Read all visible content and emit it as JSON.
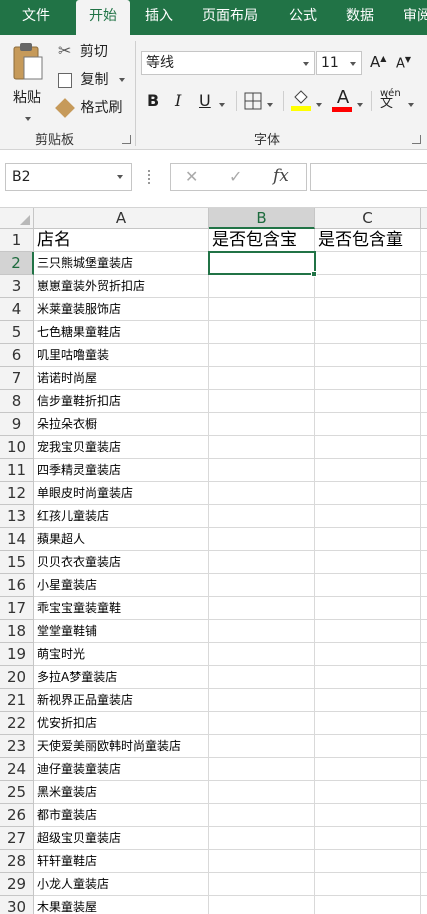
{
  "ribbon_tabs": [
    {
      "label": "文件",
      "active": false
    },
    {
      "label": "开始",
      "active": true
    },
    {
      "label": "插入",
      "active": false
    },
    {
      "label": "页面布局",
      "active": false
    },
    {
      "label": "公式",
      "active": false
    },
    {
      "label": "数据",
      "active": false
    },
    {
      "label": "审阅",
      "active": false
    }
  ],
  "clipboard": {
    "paste_label": "粘贴",
    "cut_label": "剪切",
    "copy_label": "复制",
    "format_painter_label": "格式刷",
    "group_label": "剪贴板"
  },
  "font": {
    "font_name": "等线",
    "font_size": "11",
    "bold_label": "B",
    "italic_label": "I",
    "underline_label": "U",
    "font_color_label": "A",
    "grow_label": "A",
    "shrink_label": "A",
    "phonetic_label": "wén",
    "group_label": "字体",
    "fill_color": "#FFFF00",
    "text_color": "#FF0000"
  },
  "formula_bar": {
    "name_box": "B2",
    "fx_label": "fx",
    "cancel_glyph": "✕",
    "enter_glyph": "✓",
    "formula": ""
  },
  "sheet": {
    "selected_cell": "B2",
    "columns": [
      "A",
      "B",
      "C"
    ],
    "rows": [
      {
        "n": "1",
        "a": "店名",
        "b": "是否包含宝",
        "c": "是否包含童"
      },
      {
        "n": "2",
        "a": "三只熊城堡童装店",
        "b": "",
        "c": ""
      },
      {
        "n": "3",
        "a": "崽崽童装外贸折扣店",
        "b": "",
        "c": ""
      },
      {
        "n": "4",
        "a": "米莱童装服饰店",
        "b": "",
        "c": ""
      },
      {
        "n": "5",
        "a": "七色糖果童鞋店",
        "b": "",
        "c": ""
      },
      {
        "n": "6",
        "a": "叽里咕噜童装",
        "b": "",
        "c": ""
      },
      {
        "n": "7",
        "a": "诺诺时尚屋",
        "b": "",
        "c": ""
      },
      {
        "n": "8",
        "a": "信步童鞋折扣店",
        "b": "",
        "c": ""
      },
      {
        "n": "9",
        "a": "朵拉朵衣橱",
        "b": "",
        "c": ""
      },
      {
        "n": "10",
        "a": "宠我宝贝童装店",
        "b": "",
        "c": ""
      },
      {
        "n": "11",
        "a": "四季精灵童装店",
        "b": "",
        "c": ""
      },
      {
        "n": "12",
        "a": "单眼皮时尚童装店",
        "b": "",
        "c": ""
      },
      {
        "n": "13",
        "a": "红孩儿童装店",
        "b": "",
        "c": ""
      },
      {
        "n": "14",
        "a": "蘋果超人",
        "b": "",
        "c": ""
      },
      {
        "n": "15",
        "a": "贝贝衣衣童装店",
        "b": "",
        "c": ""
      },
      {
        "n": "16",
        "a": "小星童装店",
        "b": "",
        "c": ""
      },
      {
        "n": "17",
        "a": "乖宝宝童装童鞋",
        "b": "",
        "c": ""
      },
      {
        "n": "18",
        "a": "堂堂童鞋铺",
        "b": "",
        "c": ""
      },
      {
        "n": "19",
        "a": "萌宝时光",
        "b": "",
        "c": ""
      },
      {
        "n": "20",
        "a": "多拉A梦童装店",
        "b": "",
        "c": ""
      },
      {
        "n": "21",
        "a": "新视界正品童装店",
        "b": "",
        "c": ""
      },
      {
        "n": "22",
        "a": "优安折扣店",
        "b": "",
        "c": ""
      },
      {
        "n": "23",
        "a": "天使爱美丽欧韩时尚童装店",
        "b": "",
        "c": ""
      },
      {
        "n": "24",
        "a": "迪仔童装童装店",
        "b": "",
        "c": ""
      },
      {
        "n": "25",
        "a": "黑米童装店",
        "b": "",
        "c": ""
      },
      {
        "n": "26",
        "a": "都市童装店",
        "b": "",
        "c": ""
      },
      {
        "n": "27",
        "a": "超级宝贝童装店",
        "b": "",
        "c": ""
      },
      {
        "n": "28",
        "a": "轩轩童鞋店",
        "b": "",
        "c": ""
      },
      {
        "n": "29",
        "a": "小龙人童装店",
        "b": "",
        "c": ""
      },
      {
        "n": "30",
        "a": "木果童装屋",
        "b": "",
        "c": ""
      }
    ]
  }
}
